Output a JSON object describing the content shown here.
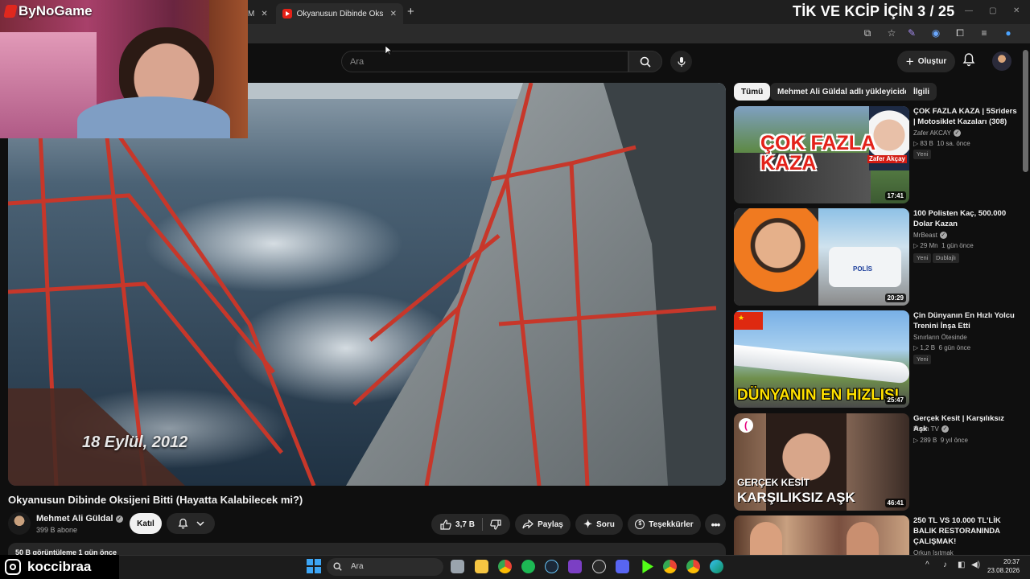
{
  "browser": {
    "tabs": [
      {
        "label": "M",
        "active": false
      },
      {
        "label": "Okyanusun Dibinde Oksijeni Bi",
        "active": true
      }
    ],
    "new_tab": "+",
    "close_glyph": "✕"
  },
  "stream_overlay": {
    "brand": "ByNoGame",
    "headline": "TİK VE KCİP İÇİN 3 / 25",
    "streamer": "koccibraa"
  },
  "youtube": {
    "search_placeholder": "Ara",
    "create_label": "Oluştur"
  },
  "video": {
    "caption": "18 Eylül, 2012",
    "title": "Okyanusun Dibinde Oksijeni Bitti (Hayatta Kalabilecek mi?)",
    "channel": "Mehmet Ali Güldal",
    "subscribers": "399 B abone",
    "join_label": "Katıl",
    "likes": "3,7 B",
    "share_label": "Paylaş",
    "ask_label": "Soru",
    "thanks_label": "Teşekkürler",
    "description_head": "50 B görüntüleme  1 gün önce"
  },
  "chips": [
    "Tümü",
    "Mehmet Ali Güldal adlı yükleyiciden",
    "İlgili"
  ],
  "recommendations": [
    {
      "title": "ÇOK FAZLA KAZA | 5Sriders | Motosiklet Kazaları (308)",
      "channel": "Zafer AKCAY",
      "views": "▷ 83 B",
      "age": "10 sa. önce",
      "duration": "17:41",
      "badges": [
        "Yeni"
      ],
      "thumb_text": "ÇOK FAZLA KAZA",
      "thumb_name": "Zafer Akçay"
    },
    {
      "title": "100 Polisten Kaç, 500.000 Dolar Kazan",
      "channel": "MrBeast",
      "views": "▷ 29 Mn",
      "age": "1 gün önce",
      "duration": "20:29",
      "badges": [
        "Yeni",
        "Dublajlı"
      ],
      "thumb_text": "POLİS"
    },
    {
      "title": "Çin Dünyanın En Hızlı Yolcu Trenini İnşa Etti",
      "channel": "Sınırların Ötesinde",
      "views": "▷ 1,2 B",
      "age": "6 gün önce",
      "duration": "25:47",
      "badges": [
        "Yeni"
      ],
      "thumb_text": "DÜNYANIN EN HIZLISI"
    },
    {
      "title": "Gerçek Kesit | Karşılıksız Aşk",
      "channel": "Flash TV",
      "views": "▷ 289 B",
      "age": "9 yıl önce",
      "duration": "46:41",
      "badges": [],
      "thumb_text_1": "GERÇEK KESİT",
      "thumb_text_2": "KARŞILIKSIZ AŞK"
    },
    {
      "title": "250 TL VS 10.000 TL'LİK BALIK RESTORANINDA ÇALIŞMAK!",
      "channel": "Orkun Işıtmak",
      "views": "",
      "age": "",
      "duration": "",
      "badges": []
    }
  ],
  "taskbar": {
    "search_placeholder": "Ara",
    "time": "20:37",
    "date": "23.08.2026"
  },
  "colors": {
    "background": "#0f0f0f",
    "chip_selected": "#f1f1f1",
    "brand_red": "#e0281e",
    "pill_bg": "#272727"
  }
}
